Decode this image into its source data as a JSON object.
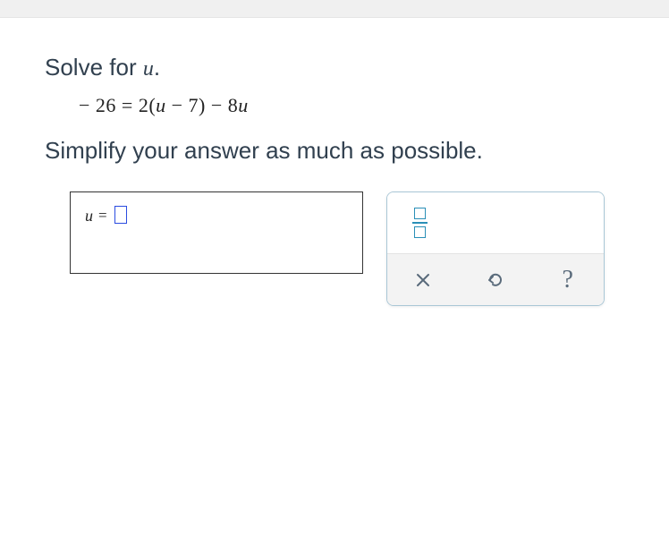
{
  "prompt": {
    "lead": "Solve for ",
    "variable": "u",
    "trail": "."
  },
  "equation": "− 26 = 2(u − 7) − 8u",
  "instruction": "Simplify your answer as much as possible.",
  "answer": {
    "variable": "u",
    "equals": "=",
    "value": ""
  },
  "tools": {
    "fraction": "fraction",
    "clear": "clear",
    "undo": "undo",
    "help": "?"
  }
}
